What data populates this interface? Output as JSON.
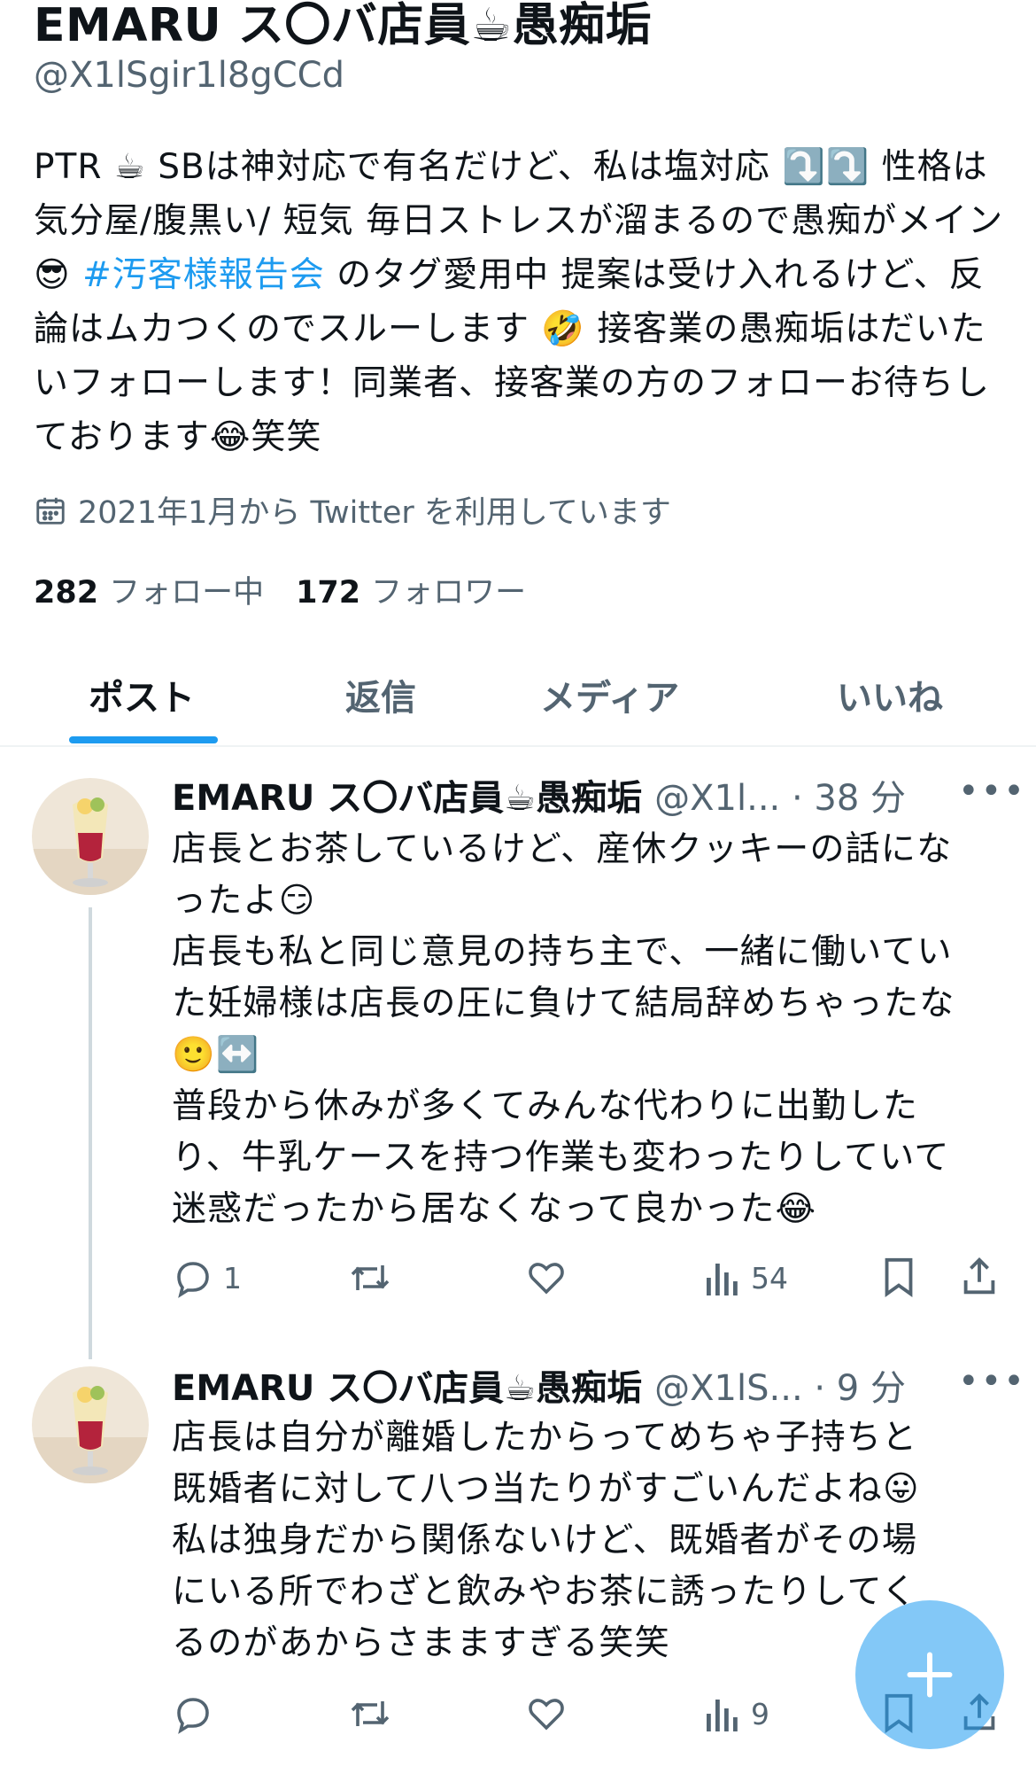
{
  "profile": {
    "name": "EMARU ス〇バ店員☕愚痴垢",
    "handle": "@X1lSgir1l8gCCd",
    "bio_1": "PTR ☕ SBは神対応で有名だけど、私は塩対応 ⤵️⤵️ 性格は気分屋/腹黒い/ 短気 毎日ストレスが溜まるので愚痴がメイン 😎 ",
    "bio_tag": "#汚客様報告会",
    "bio_2": " のタグ愛用中 提案は受け入れるけど、反論はムカつくのでスルーします 🤣 接客業の愚痴垢はだいたいフォローします！同業者、接客業の方のフォローお待ちしております😂笑笑",
    "joined": "2021年1月から Twitter を利用しています",
    "following_count": "282",
    "following_label": "フォロー中",
    "followers_count": "172",
    "followers_label": "フォロワー"
  },
  "tabs": [
    "ポスト",
    "返信",
    "メディア",
    "いいね"
  ],
  "tweets": [
    {
      "name": "EMARU ス〇バ店員☕愚痴垢",
      "meta": "@X1l... · 38 分",
      "text_lines": [
        "店長とお茶しているけど、産休クッキーの話にな",
        "ったよ😏",
        "店長も私と同じ意見の持ち主で、一緒に働いてい",
        "た妊婦様は店長の圧に負けて結局辞めちゃったな",
        "🙂↔️",
        "普段から休みが多くてみんな代わりに出勤した",
        "り、牛乳ケースを持つ作業も変わったりしていて",
        "迷惑だったから居なくなって良かった😂"
      ],
      "replies": "1",
      "views": "54"
    },
    {
      "name": "EMARU ス〇バ店員☕愚痴垢",
      "meta": "@X1lS... · 9 分",
      "text_lines": [
        "店長は自分が離婚したからってめちゃ子持ちと",
        "既婚者に対して八つ当たりがすごいんだよね😛",
        "私は独身だから関係ないけど、既婚者がその場",
        "にいる所でわざと飲みやお茶に誘ったりしてく",
        "るのがあからさまますぎる笑笑"
      ],
      "replies": "",
      "views": "9"
    }
  ],
  "colors": {
    "accent": "#1d9bf0",
    "secondary": "#536471",
    "text": "#0f1419"
  },
  "icons": [
    "calendar-icon",
    "reply-icon",
    "retweet-icon",
    "like-icon",
    "views-icon",
    "bookmark-icon",
    "share-icon",
    "more-icon",
    "compose-plus-icon"
  ]
}
